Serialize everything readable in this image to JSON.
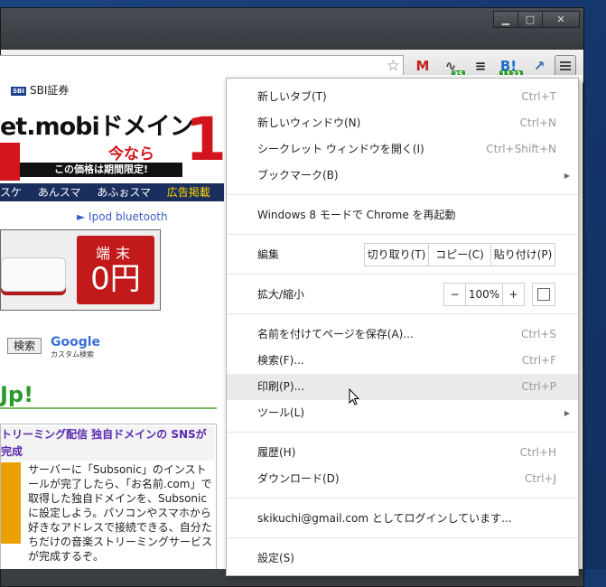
{
  "window": {
    "minimize": "▁",
    "maximize": "□",
    "close": "✕"
  },
  "toolbar": {
    "star_icon": "star-icon",
    "extensions": [
      {
        "name": "gmail-icon",
        "glyph": "M",
        "color": "#c5221f",
        "badge": ""
      },
      {
        "name": "stats-icon",
        "glyph": "∿",
        "color": "#444",
        "badge": "35"
      },
      {
        "name": "layers-icon",
        "glyph": "≡",
        "color": "#222",
        "badge": ""
      },
      {
        "name": "hatena-bookmark-icon",
        "glyph": "B!",
        "color": "#1a6fd0",
        "badge": "1133"
      },
      {
        "name": "chart-icon",
        "glyph": "↗",
        "color": "#2a6fb0",
        "badge": ""
      }
    ]
  },
  "webpage": {
    "sbi": "SBI証券",
    "sbi_logo": "SBI",
    "banner_title": "et.mobiドメイン",
    "banner_now": "今なら",
    "banner_big": "1",
    "banner_strip": "この価格は期間限定!",
    "banner_side_letters": "o",
    "nav": [
      "スケ",
      "あんスマ",
      "あふぉスマ"
    ],
    "nav_ad": "広告掲載",
    "ipod_link": "► Ipod bluetooth",
    "ad_line1": "端末",
    "ad_line2": "0円",
    "search_button": "検索",
    "google": "Google",
    "google_sub": "カスタム検索",
    "up_heading": "Jp!",
    "article_title": "トリーミング配信 独自ドメインの SNSが完成",
    "article_text": "サーバーに「Subsonic」のインストールが完了したら、「お名前.com」で取得した独自ドメインを、Subsonicに設定しよう。パソコンやスマホから好きなアドレスで接続できる、自分たちだけの音楽ストリーミングサービスが完成するぞ。"
  },
  "menu": {
    "new_tab": {
      "label": "新しいタブ(T)",
      "shortcut": "Ctrl+T"
    },
    "new_window": {
      "label": "新しいウィンドウ(N)",
      "shortcut": "Ctrl+N"
    },
    "incognito": {
      "label": "シークレット ウィンドウを開く(I)",
      "shortcut": "Ctrl+Shift+N"
    },
    "bookmarks": {
      "label": "ブックマーク(B)"
    },
    "relaunch": {
      "label": "Windows 8 モードで Chrome を再起動"
    },
    "edit": {
      "label": "編集",
      "cut": "切り取り(T)",
      "copy": "コピー(C)",
      "paste": "貼り付け(P)"
    },
    "zoom": {
      "label": "拡大/縮小",
      "minus": "−",
      "value": "100%",
      "plus": "+"
    },
    "save_page": {
      "label": "名前を付けてページを保存(A)...",
      "shortcut": "Ctrl+S"
    },
    "find": {
      "label": "検索(F)...",
      "shortcut": "Ctrl+F"
    },
    "print": {
      "label": "印刷(P)...",
      "shortcut": "Ctrl+P"
    },
    "tools": {
      "label": "ツール(L)"
    },
    "history": {
      "label": "履歴(H)",
      "shortcut": "Ctrl+H"
    },
    "downloads": {
      "label": "ダウンロード(D)",
      "shortcut": "Ctrl+J"
    },
    "signed_in": {
      "label": "skikuchi@gmail.com としてログインしています..."
    },
    "settings": {
      "label": "設定(S)"
    }
  }
}
